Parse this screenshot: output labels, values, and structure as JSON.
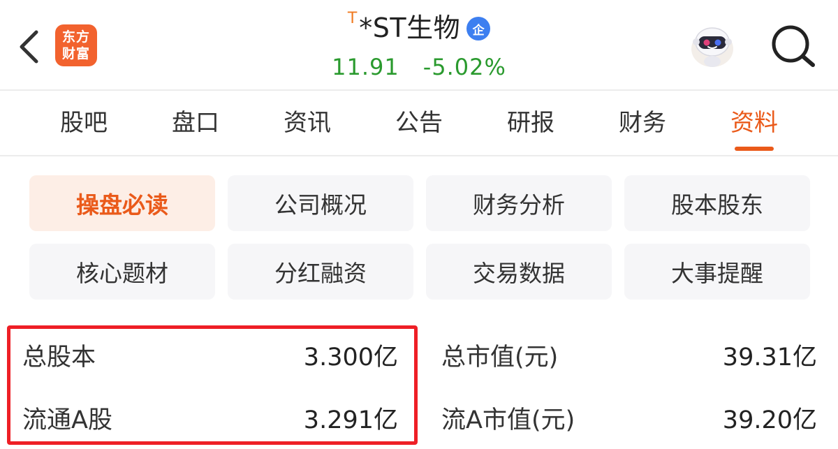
{
  "header": {
    "logo_line1": "东方",
    "logo_line2": "财富",
    "t_badge": "T",
    "stock_name": "*ST生物",
    "corp_badge": "企",
    "price": "11.91",
    "change_pct": "-5.02%",
    "price_color": "#2a9a2e",
    "brand_color": "#f2622e"
  },
  "tabs": [
    {
      "label": "股吧"
    },
    {
      "label": "盘口"
    },
    {
      "label": "资讯"
    },
    {
      "label": "公告"
    },
    {
      "label": "研报"
    },
    {
      "label": "财务"
    },
    {
      "label": "资料",
      "active": true
    }
  ],
  "sub_tabs": [
    {
      "label": "操盘必读",
      "active": true
    },
    {
      "label": "公司概况"
    },
    {
      "label": "财务分析"
    },
    {
      "label": "股本股东"
    },
    {
      "label": "核心题材"
    },
    {
      "label": "分红融资"
    },
    {
      "label": "交易数据"
    },
    {
      "label": "大事提醒"
    }
  ],
  "stats": {
    "total_shares_label": "总股本",
    "total_shares_value": "3.300亿",
    "float_a_label": "流通A股",
    "float_a_value": "3.291亿",
    "market_cap_label": "总市值(元)",
    "market_cap_value": "39.31亿",
    "float_cap_label": "流A市值(元)",
    "float_cap_value": "39.20亿"
  },
  "icons": [
    "back-arrow-icon",
    "eastmoney-logo",
    "robot-assistant-icon",
    "search-icon"
  ],
  "accent_color": "#ea5a1a",
  "highlight_color": "#ee1f26"
}
